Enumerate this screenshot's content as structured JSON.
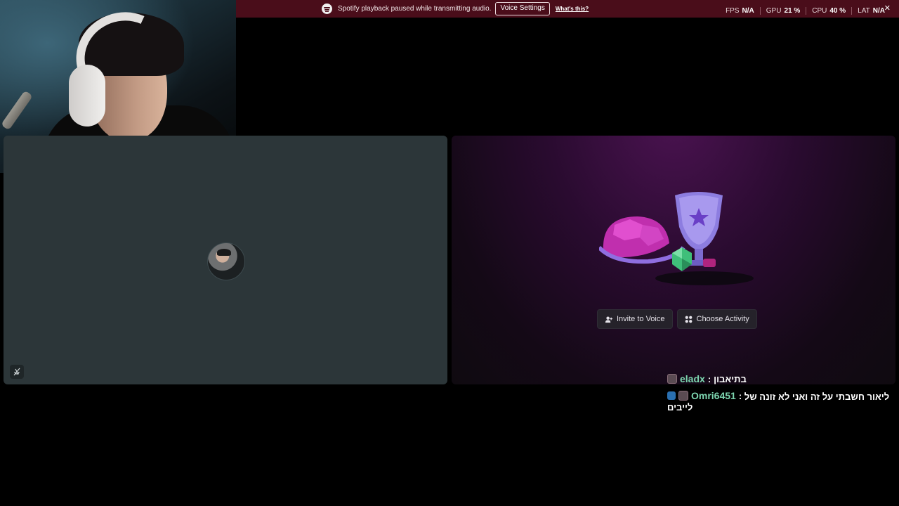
{
  "notice": {
    "message": "Spotify playback paused while transmitting audio.",
    "voice_settings_label": "Voice Settings",
    "whats_this_label": "What's this?",
    "close_label": "✕"
  },
  "stats": [
    {
      "label": "FPS",
      "value": "N/A"
    },
    {
      "label": "GPU",
      "value": "21 %"
    },
    {
      "label": "CPU",
      "value": "40 %"
    },
    {
      "label": "LAT",
      "value": "N/A"
    }
  ],
  "activity": {
    "invite_label": "Invite to Voice",
    "choose_label": "Choose Activity"
  },
  "chat": [
    {
      "user": "eladx",
      "message": "בתיאבון",
      "badges": [
        "mod"
      ]
    },
    {
      "user": "Omri6451",
      "message": "ליאור חשבתי על זה ואני לא זונה של לייבים",
      "badges": [
        "star",
        "mod"
      ]
    }
  ],
  "colors": {
    "notice_bg": "#4a0d1a",
    "tile_bg": "#2c3639",
    "username": "#7dd6b0"
  }
}
